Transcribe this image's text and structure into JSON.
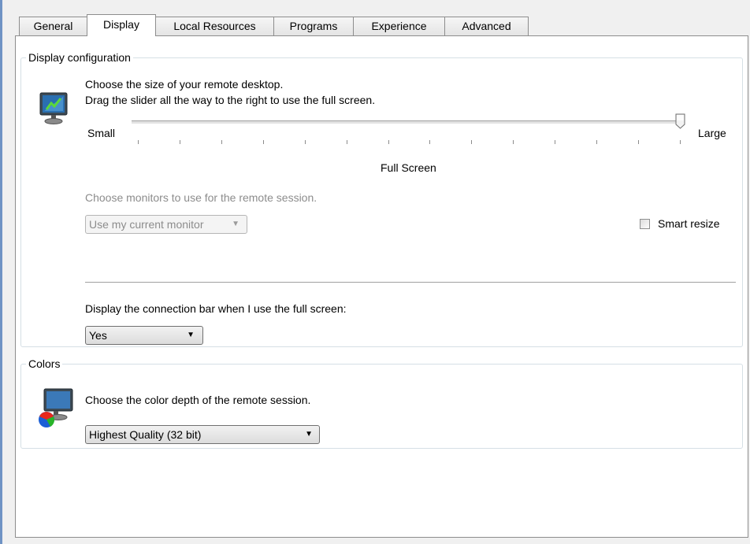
{
  "tabs": [
    {
      "label": "General",
      "active": false
    },
    {
      "label": "Display",
      "active": true
    },
    {
      "label": "Local Resources",
      "active": false
    },
    {
      "label": "Programs",
      "active": false
    },
    {
      "label": "Experience",
      "active": false
    },
    {
      "label": "Advanced",
      "active": false
    }
  ],
  "display_config": {
    "title": "Display configuration",
    "icon": "monitor-icon",
    "line1": "Choose the size of your remote desktop.",
    "line2": "Drag the slider all the way to the right to use the full screen.",
    "slider": {
      "min_label": "Small",
      "max_label": "Large",
      "value_fraction": 1.0,
      "tick_count": 14
    },
    "slider_value_text": "Full Screen",
    "monitors_label": "Choose monitors to use for the remote session.",
    "monitors_select": {
      "value": "Use my current monitor",
      "enabled": false
    },
    "smart_resize": {
      "label": "Smart resize",
      "checked": false
    },
    "connection_bar_label": "Display the connection bar when I use the full screen:",
    "connection_bar_select": {
      "value": "Yes"
    }
  },
  "colors": {
    "title": "Colors",
    "icon": "color-monitor-icon",
    "label": "Choose the color depth of the remote session.",
    "depth_select": {
      "value": "Highest Quality (32 bit)"
    }
  }
}
